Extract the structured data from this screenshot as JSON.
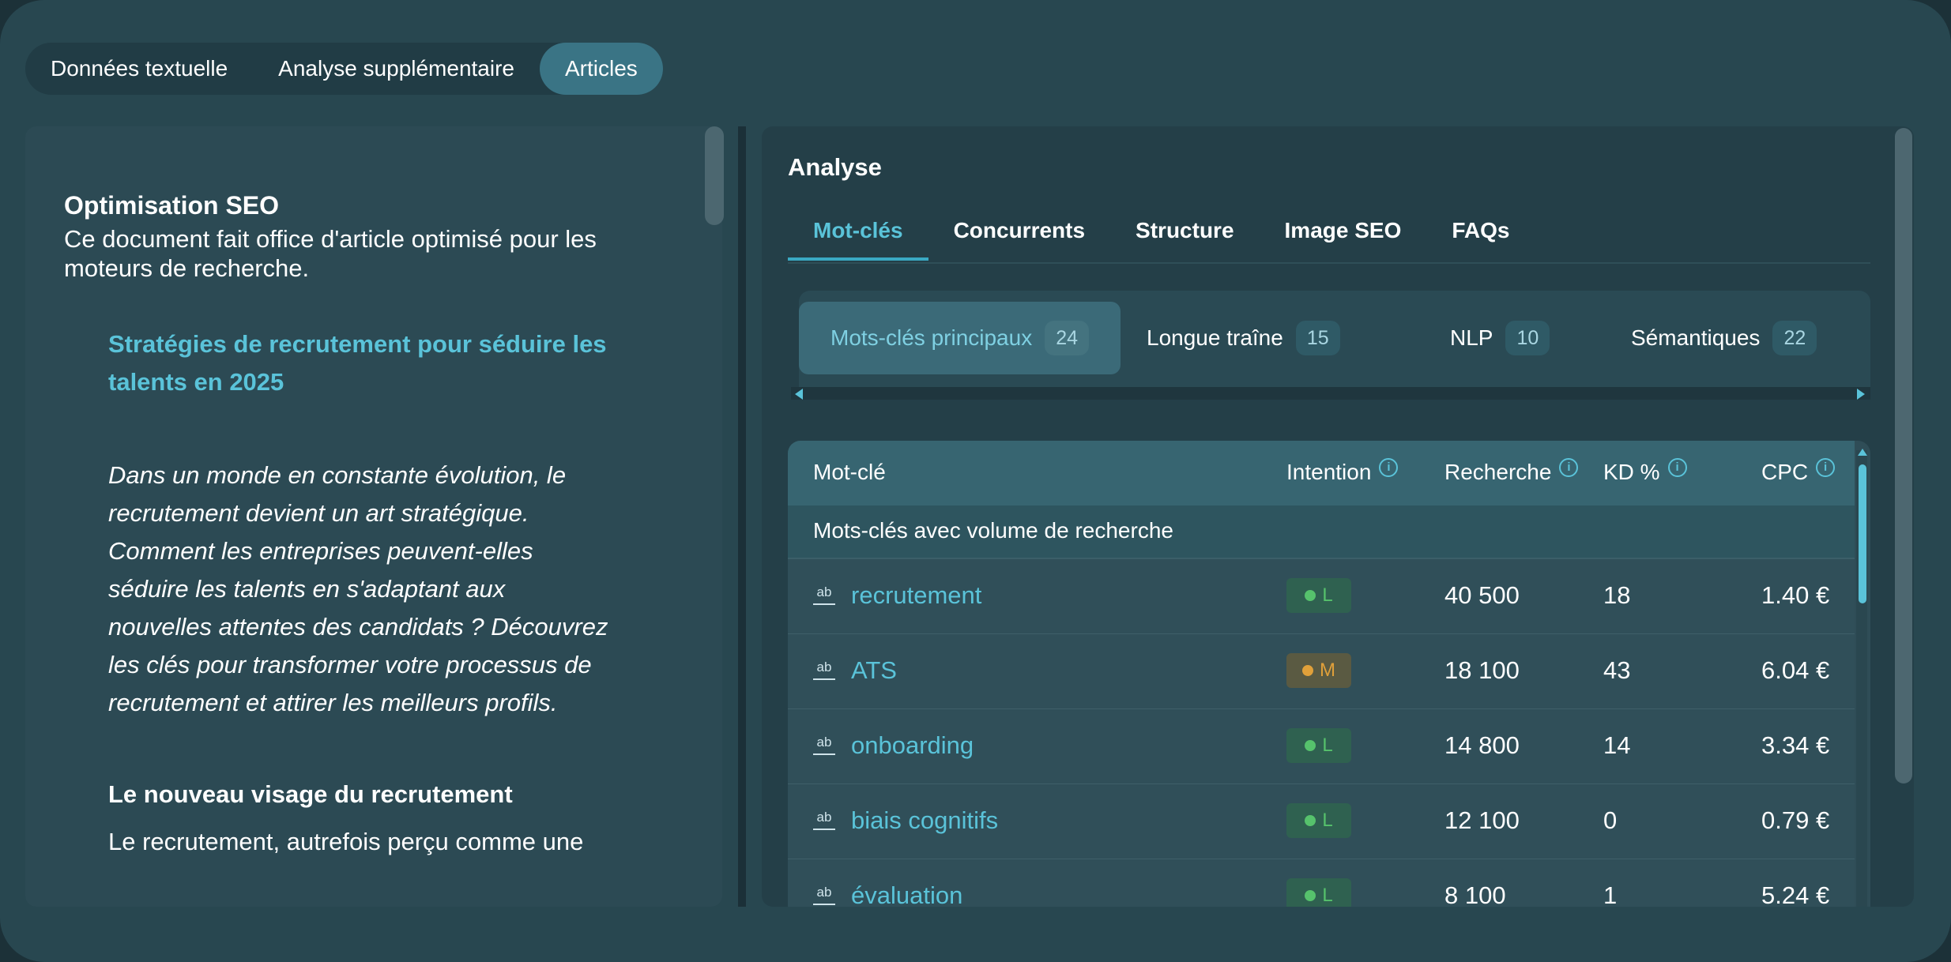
{
  "top_tabs": [
    {
      "label": "Données textuelle"
    },
    {
      "label": "Analyse supplémentaire"
    },
    {
      "label": "Articles"
    }
  ],
  "document": {
    "heading": "Optimisation SEO",
    "description": "Ce document fait office d'article optimisé pour les moteurs de recherche.",
    "article_title": "Stratégies de recrutement pour séduire les talents en 2025",
    "intro": "Dans un monde en constante évolution, le recrutement devient un art stratégique. Comment les entreprises peuvent-elles séduire les talents en s'adaptant aux nouvelles attentes des candidats ? Découvrez les clés pour transformer votre processus de recrutement et attirer les meilleurs profils.",
    "section_heading": "Le nouveau visage du recrutement",
    "section_text": "Le recrutement, autrefois perçu comme une"
  },
  "analysis": {
    "title": "Analyse",
    "tabs": [
      {
        "label": "Mot-clés"
      },
      {
        "label": "Concurrents"
      },
      {
        "label": "Structure"
      },
      {
        "label": "Image SEO"
      },
      {
        "label": "FAQs"
      }
    ],
    "subtabs": [
      {
        "label": "Mots-clés principaux",
        "count": "24"
      },
      {
        "label": "Longue traîne",
        "count": "15"
      },
      {
        "label": "NLP",
        "count": "10"
      },
      {
        "label": "Sémantiques",
        "count": "22"
      }
    ],
    "table": {
      "headers": {
        "keyword": "Mot-clé",
        "intent": "Intention",
        "search": "Recherche",
        "kd": "KD %",
        "cpc": "CPC"
      },
      "info_glyph": "i",
      "group_label": "Mots-clés avec volume de recherche",
      "rows": [
        {
          "keyword": "recrutement",
          "intent": "L",
          "search": "40 500",
          "kd": "18",
          "cpc": "1.40 €"
        },
        {
          "keyword": "ATS",
          "intent": "M",
          "search": "18 100",
          "kd": "43",
          "cpc": "6.04 €"
        },
        {
          "keyword": "onboarding",
          "intent": "L",
          "search": "14 800",
          "kd": "14",
          "cpc": "3.34 €"
        },
        {
          "keyword": "biais cognitifs",
          "intent": "L",
          "search": "12 100",
          "kd": "0",
          "cpc": "0.79 €"
        },
        {
          "keyword": "évaluation",
          "intent": "L",
          "search": "8 100",
          "kd": "1",
          "cpc": "5.24 €"
        }
      ]
    },
    "keyword_icon_glyph": "ab"
  },
  "colors": {
    "accent": "#5ac3d9",
    "intent_low": "#56c26c",
    "intent_medium": "#e0a03a",
    "panel_bg": "#284750"
  }
}
